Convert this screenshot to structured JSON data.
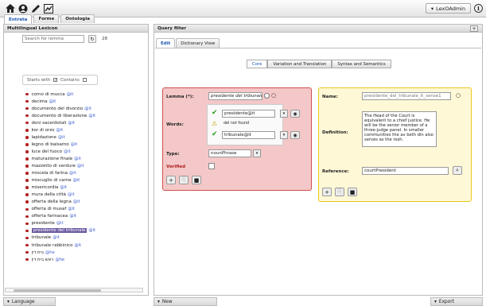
{
  "topbar": {
    "icons": [
      "home-icon",
      "user-icon",
      "edit-icon",
      "chart-icon"
    ],
    "admin_label": "LexOAdmin",
    "info_label": "i"
  },
  "left": {
    "title": "Multilingual Lexicon",
    "tabs": [
      "Entrata",
      "Forme",
      "Ontologia"
    ],
    "search_placeholder": "Search for lemma",
    "count": "28",
    "filter_starts": "Starts with",
    "filter_contains": "Contains",
    "entries": [
      {
        "label": "corno di mucca",
        "lang": "@it"
      },
      {
        "label": "decima",
        "lang": "@it"
      },
      {
        "label": "documento del divorzio",
        "lang": "@it"
      },
      {
        "label": "documento di liberazione",
        "lang": "@it"
      },
      {
        "label": "doni sacerdotali",
        "lang": "@it"
      },
      {
        "label": "kor di orzo",
        "lang": "@it"
      },
      {
        "label": "lapidazione",
        "lang": "@it"
      },
      {
        "label": "legno di balsamo",
        "lang": "@it"
      },
      {
        "label": "luce del fuoco",
        "lang": "@it"
      },
      {
        "label": "maturazione finale",
        "lang": "@it"
      },
      {
        "label": "mazzetto di verdure",
        "lang": "@it"
      },
      {
        "label": "miscela di farina",
        "lang": "@it"
      },
      {
        "label": "miscuglio di carne",
        "lang": "@it"
      },
      {
        "label": "misericordia",
        "lang": "@it"
      },
      {
        "label": "mura della città",
        "lang": "@it"
      },
      {
        "label": "offerta della legna",
        "lang": "@it"
      },
      {
        "label": "offerta di musaf",
        "lang": "@it"
      },
      {
        "label": "offerta farinacea",
        "lang": "@it"
      },
      {
        "label": "presidente",
        "lang": "@it"
      },
      {
        "label": "presidente del tribunale",
        "lang": "@it"
      },
      {
        "label": "tribunale",
        "lang": "@it"
      },
      {
        "label": "tribunale rabbinico",
        "lang": "@it"
      },
      {
        "label": "בית דין",
        "lang": "@he"
      },
      {
        "label": "ראש בית דין",
        "lang": "@he"
      }
    ],
    "selected_index": 19
  },
  "right": {
    "title": "Query filter",
    "plus": "+",
    "tabs": [
      "Edit",
      "Dictionary View"
    ],
    "segments": [
      "Core",
      "Variation and Translation",
      "Syntax and Semantics"
    ]
  },
  "lemma": {
    "lemma_label": "Lemma (*):",
    "lemma_value": "presidente del tribunale",
    "words_label": "Words:",
    "word1": "presidente@it",
    "not_found": "del not found",
    "word2": "tribunale@it",
    "type_label": "Type:",
    "type_value": "nounPhrase",
    "verified_label": "Verified"
  },
  "sense": {
    "name_label": "Name:",
    "name_value": "presidente_del_tribunale_it_sense1",
    "def_label": "Definition:",
    "def_value": "The Head of the Court is equivalent to a chief justice. He will be the senior member of a three-judge panel. In smaller communities the av beth din also serves as the rosh.",
    "ref_label": "Reference:",
    "ref_value": "courtPresident"
  },
  "bottom": {
    "language": "Language",
    "new": "New",
    "export": "Export"
  }
}
